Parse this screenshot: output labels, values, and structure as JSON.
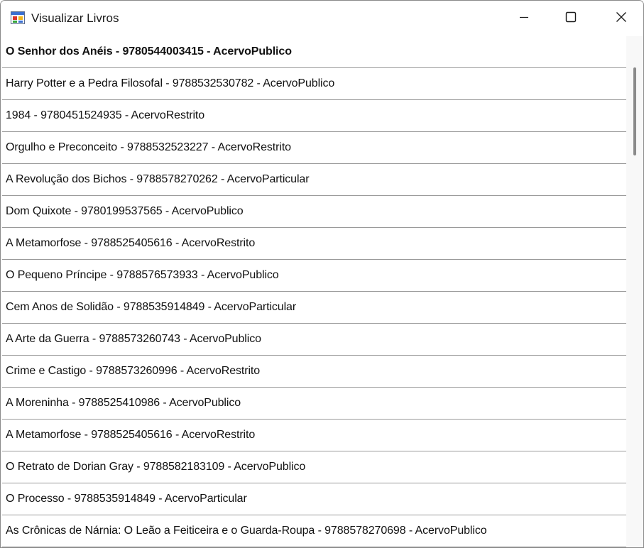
{
  "window": {
    "title": "Visualizar Livros"
  },
  "icons": {
    "app": "windows-form-icon",
    "minimize": "minimize-icon",
    "maximize": "maximize-icon",
    "close": "close-icon"
  },
  "list": {
    "selected_index": 0,
    "items": [
      "O Senhor dos Anéis - 9780544003415 - AcervoPublico",
      "Harry Potter e a Pedra Filosofal - 9788532530782 - AcervoPublico",
      "1984 - 9780451524935 - AcervoRestrito",
      "Orgulho e Preconceito - 9788532523227 - AcervoRestrito",
      "A Revolução dos Bichos - 9788578270262 - AcervoParticular",
      "Dom Quixote - 9780199537565 - AcervoPublico",
      "A Metamorfose - 9788525405616 - AcervoRestrito",
      "O Pequeno Príncipe - 9788576573933 - AcervoPublico",
      "Cem Anos de Solidão - 9788535914849 - AcervoParticular",
      "A Arte da Guerra - 9788573260743 - AcervoPublico",
      "Crime e Castigo - 9788573260996 - AcervoRestrito",
      "A Moreninha - 9788525410986 - AcervoPublico",
      "A Metamorfose - 9788525405616 - AcervoRestrito",
      "O Retrato de Dorian Gray - 9788582183109 - AcervoPublico",
      "O Processo - 9788535914849 - AcervoParticular",
      "As Crônicas de Nárnia: O Leão a Feiticeira e o Guarda-Roupa - 9788578270698 - AcervoPublico"
    ]
  }
}
